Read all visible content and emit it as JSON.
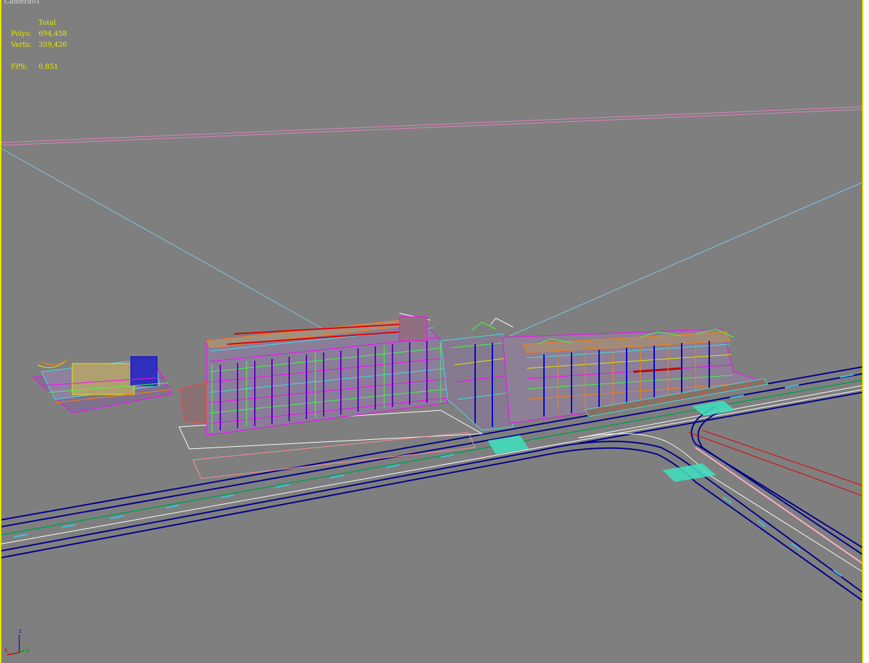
{
  "viewport": {
    "name": "Camera01",
    "background": "#7f7f7f",
    "border_color": "#e8e800"
  },
  "stats": {
    "header": "Total",
    "polys_label": "Polys:",
    "polys_value": "694,458",
    "verts_label": "Verts:",
    "verts_value": "359,426",
    "fps_label": "FPS:",
    "fps_value": "0.851",
    "color": "#e8e800"
  },
  "axis_gizmo": {
    "z": "z",
    "x": "x",
    "y": "y"
  },
  "icons": {
    "axis_gizmo": "xyz-axis-gizmo-icon"
  },
  "colors": {
    "road": "#00008b",
    "road_center": "#00a050",
    "road_dash": "#40c0e0",
    "camera_frustum": "#80c8e8",
    "horizon_plane": "#e080c0",
    "wire_magenta": "#ff00ff",
    "wire_green": "#40ff40",
    "wire_cyan": "#40e0e0",
    "wire_orange": "#ff8000",
    "wire_yellow": "#e8e800",
    "wire_blue": "#0000cc",
    "crosswalk": "#40e0c0"
  }
}
